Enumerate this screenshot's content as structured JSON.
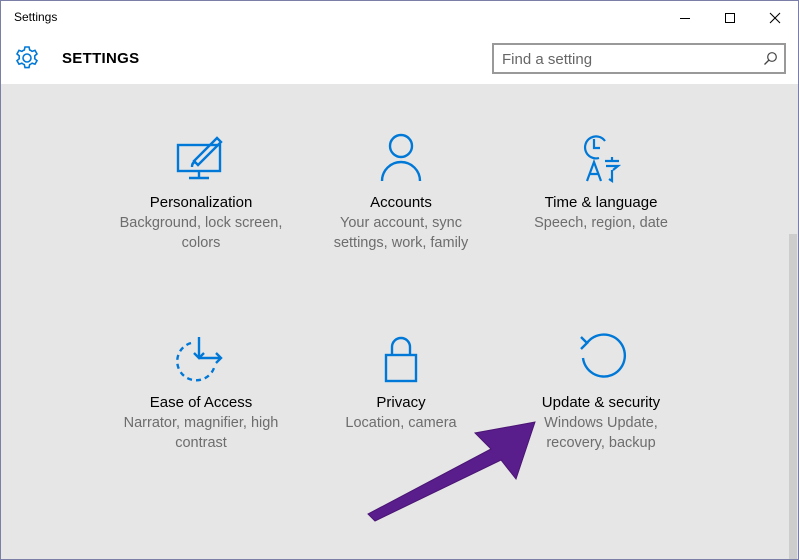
{
  "window": {
    "title": "Settings",
    "minimize_icon": "minimize-icon",
    "maximize_icon": "maximize-icon",
    "close_icon": "close-icon"
  },
  "header": {
    "icon": "gear-icon",
    "title": "SETTINGS",
    "search": {
      "placeholder": "Find a setting",
      "value": ""
    }
  },
  "accent_color": "#0078d7",
  "annotation_color": "#5a1d8c",
  "tiles": [
    {
      "icon": "personalization-icon",
      "name": "Personalization",
      "description": "Background, lock screen, colors"
    },
    {
      "icon": "accounts-icon",
      "name": "Accounts",
      "description": "Your account, sync settings, work, family"
    },
    {
      "icon": "time-language-icon",
      "name": "Time & language",
      "description": "Speech, region, date"
    },
    {
      "icon": "ease-of-access-icon",
      "name": "Ease of Access",
      "description": "Narrator, magnifier, high contrast"
    },
    {
      "icon": "privacy-icon",
      "name": "Privacy",
      "description": "Location, camera"
    },
    {
      "icon": "update-security-icon",
      "name": "Update & security",
      "description": "Windows Update, recovery, backup"
    }
  ]
}
